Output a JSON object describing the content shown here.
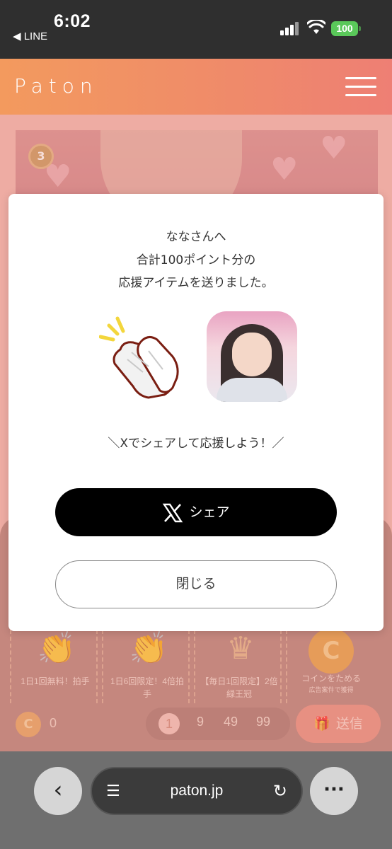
{
  "status_bar": {
    "time": "6:02",
    "back_app": "◀ LINE",
    "battery": "100"
  },
  "header": {
    "logo": "Paton"
  },
  "background": {
    "rank": "3",
    "items": [
      {
        "label": "1日1回無料！拍手"
      },
      {
        "label": "1日6回限定！4倍拍手"
      },
      {
        "label": "【毎日1回限定】2倍緑王冠"
      },
      {
        "label": "コインをためる",
        "sub": "広告案件で獲得"
      }
    ],
    "coin_symbol": "C",
    "coin_count": "0",
    "quantities": [
      "1",
      "9",
      "49",
      "99"
    ],
    "send_label": "送信"
  },
  "modal": {
    "line1": "ななさんへ",
    "line2": "合計100ポイント分の",
    "line3": "応援アイテムを送りました。",
    "share_prompt": "＼Xでシェアして応援しよう！／",
    "share_label": "シェア",
    "close_label": "閉じる"
  },
  "browser": {
    "url": "paton.jp"
  }
}
